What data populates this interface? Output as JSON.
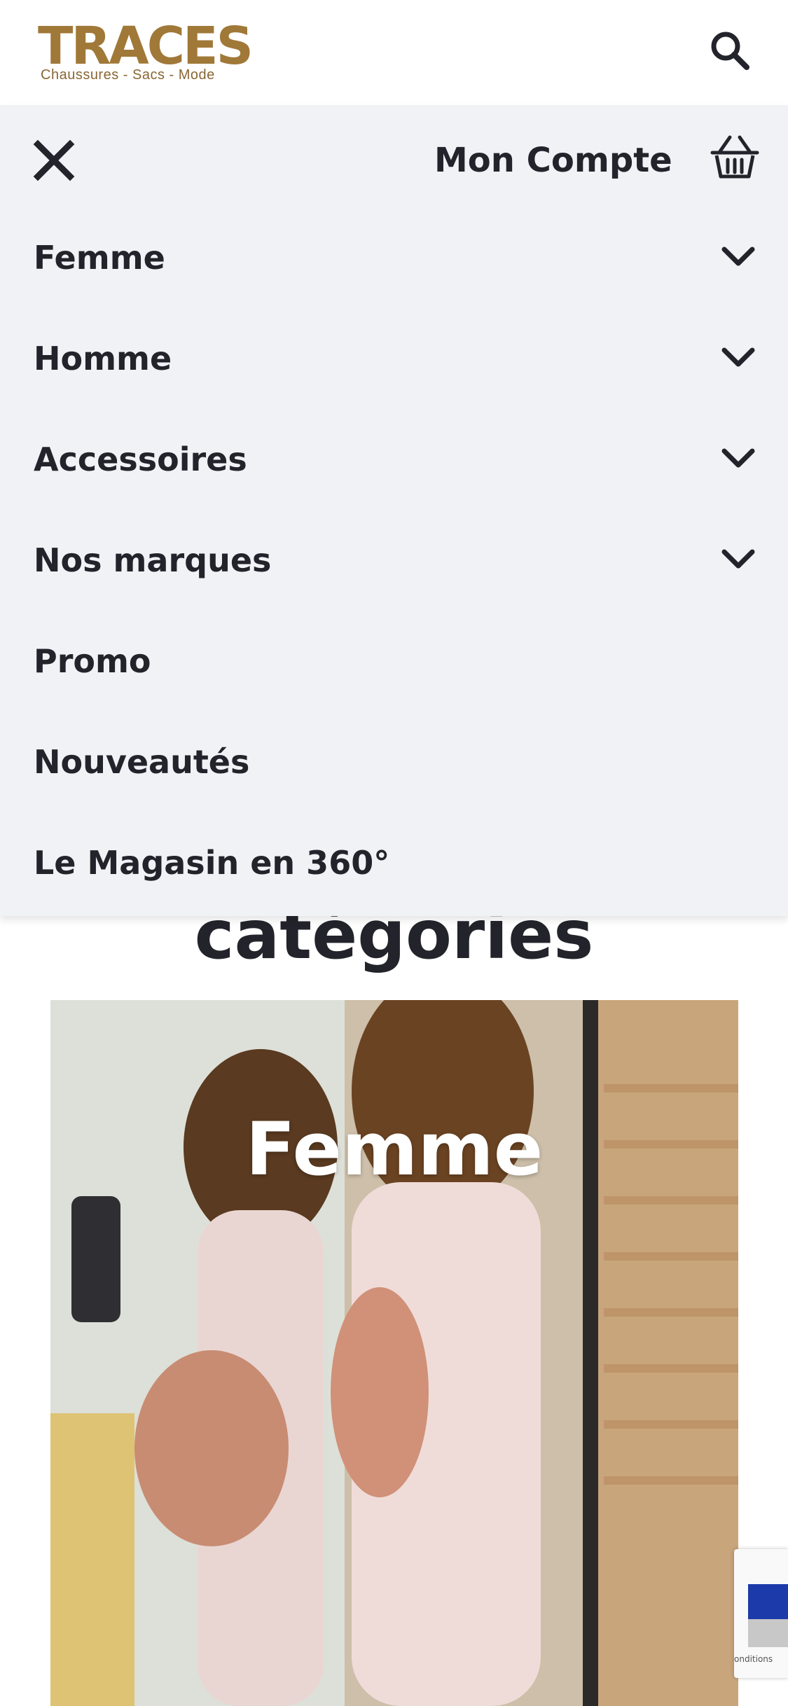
{
  "header": {
    "logo_word": "TRACES",
    "logo_tagline": "Chaussures - Sacs - Mode",
    "search_icon": "search-icon"
  },
  "drawer": {
    "close_icon": "close-icon",
    "account_label": "Mon Compte",
    "cart_icon": "basket-icon",
    "items": [
      {
        "label": "Femme",
        "has_submenu": true
      },
      {
        "label": "Homme",
        "has_submenu": true
      },
      {
        "label": "Accessoires",
        "has_submenu": true
      },
      {
        "label": "Nos marques",
        "has_submenu": true
      },
      {
        "label": "Promo",
        "has_submenu": false
      },
      {
        "label": "Nouveautés",
        "has_submenu": false
      },
      {
        "label": "Le Magasin en 360°",
        "has_submenu": false
      }
    ]
  },
  "content": {
    "section_title": "catégories",
    "hero_title": "Femme"
  },
  "recaptcha": {
    "text": "onditions"
  },
  "colors": {
    "drawer_bg": "#f1f2f5",
    "text": "#23232b",
    "logo_gold": "#a07838"
  }
}
